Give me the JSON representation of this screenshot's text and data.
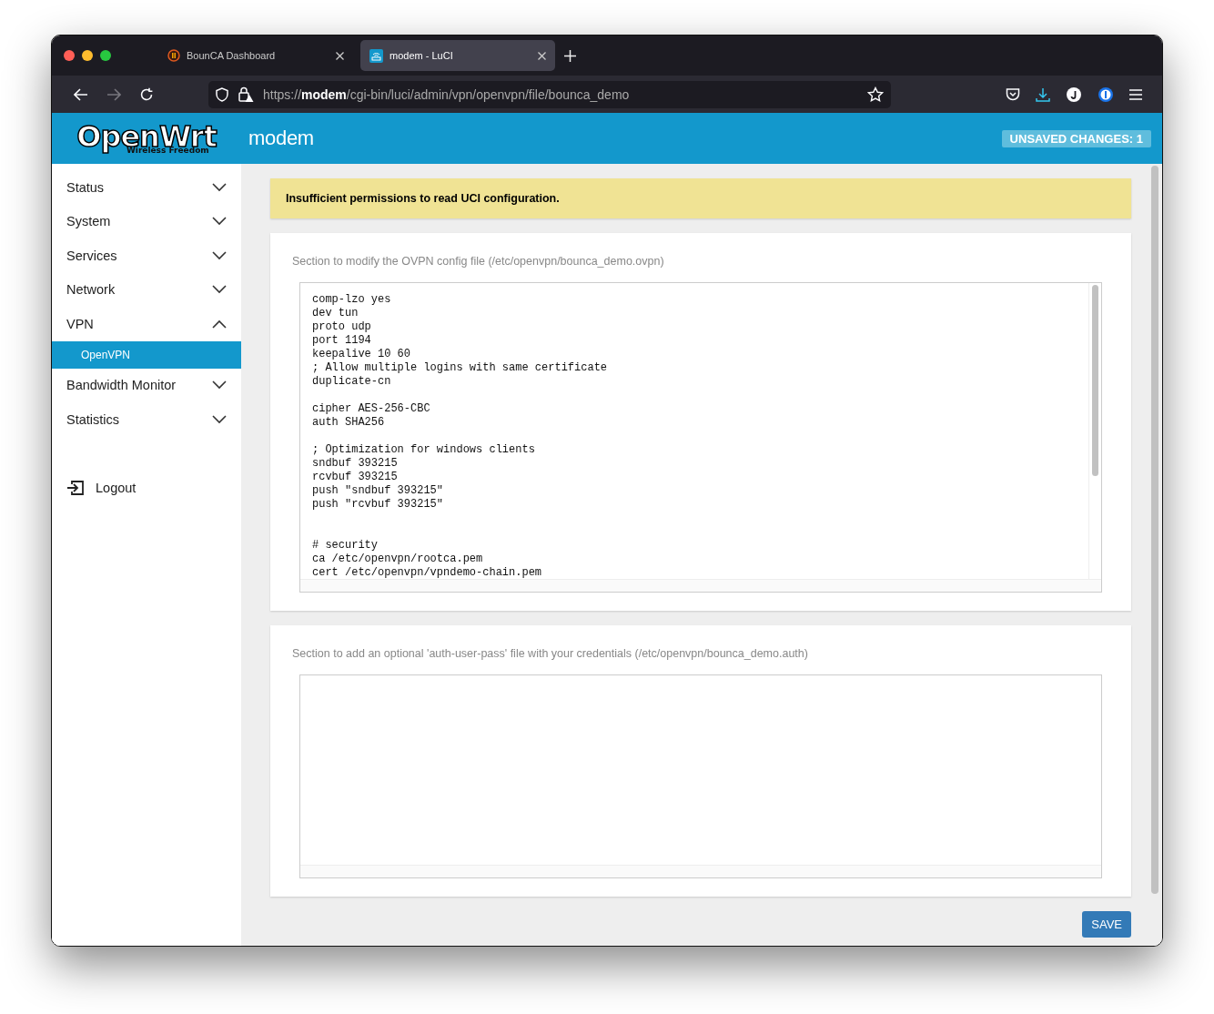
{
  "browser": {
    "tabs": [
      {
        "title": "BounCA Dashboard",
        "selected": false,
        "kind": "bounca"
      },
      {
        "title": "modem - LuCI",
        "selected": true,
        "kind": "luci"
      }
    ],
    "url": "https://**modem**/cgi-bin/luci/admin/vpn/openvpn/file/bounca_demo"
  },
  "header": {
    "logo": "OpenWrt",
    "logo_tagline": "Wireless Freedom",
    "hostname": "modem",
    "badge": "UNSAVED CHANGES: 1"
  },
  "sidebar": {
    "items": [
      {
        "label": "Status",
        "expanded": false
      },
      {
        "label": "System",
        "expanded": false
      },
      {
        "label": "Services",
        "expanded": false
      },
      {
        "label": "Network",
        "expanded": false
      },
      {
        "label": "VPN",
        "expanded": true,
        "children": [
          {
            "label": "OpenVPN",
            "selected": true
          }
        ]
      },
      {
        "label": "Bandwidth Monitor",
        "expanded": false
      },
      {
        "label": "Statistics",
        "expanded": false
      }
    ],
    "logout": "Logout"
  },
  "alert": "Insufficient permissions to read UCI configuration.",
  "sections": [
    {
      "description": "Section to modify the OVPN config file (/etc/openvpn/bounca_demo.ovpn)",
      "content": "comp-lzo yes\ndev tun\nproto udp\nport 1194\nkeepalive 10 60\n; Allow multiple logins with same certificate\nduplicate-cn\n\ncipher AES-256-CBC\nauth SHA256\n\n; Optimization for windows clients\nsndbuf 393215\nrcvbuf 393215\npush \"sndbuf 393215\"\npush \"rcvbuf 393215\"\n\n\n# security\nca /etc/openvpn/rootca.pem\ncert /etc/openvpn/vpndemo-chain.pem"
    },
    {
      "description": "Section to add an optional 'auth-user-pass' file with your credentials (/etc/openvpn/bounca_demo.auth)"
    }
  ],
  "save_button": "SAVE"
}
